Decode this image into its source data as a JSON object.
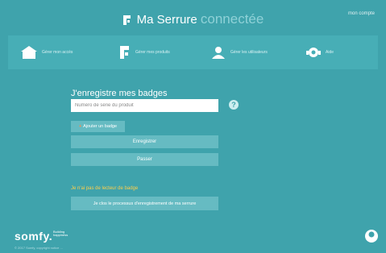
{
  "header": {
    "brand_bold": "Ma Serrure",
    "brand_light": "connectée",
    "account_label": "mon compte"
  },
  "nav": {
    "items": [
      {
        "label": "Gérer mon accès",
        "icon": "house-icon"
      },
      {
        "label": "Gérer mes produits",
        "icon": "lock-icon"
      },
      {
        "label": "Gérer les utilisateurs",
        "icon": "user-icon"
      },
      {
        "label": "Aide",
        "icon": "help-icon"
      }
    ]
  },
  "form": {
    "title": "J'enregistre mes badges",
    "serial_placeholder": "Numéro de série du produit",
    "serial_value": "",
    "help_glyph": "?",
    "add_badge_label": "Ajouter un badge",
    "add_badge_glyph": "+",
    "save_label": "Enregistrer",
    "skip_label": "Passer",
    "warning_text": "Je n'ai pas de lecteur de badge",
    "finish_label": "Je clos le processus d'enregistrement de ma serrure"
  },
  "footer": {
    "logo": "somfy.",
    "tagline_line1": "Building",
    "tagline_line2": "happiness",
    "copyright": "© 2017 Somfy, copyright notice ..."
  },
  "colors": {
    "background": "#3fa3ac",
    "nav_background": "#47aeb6",
    "button": "#66bbc2",
    "warning": "#ffcf4a",
    "accent": "#ff8a4a"
  }
}
